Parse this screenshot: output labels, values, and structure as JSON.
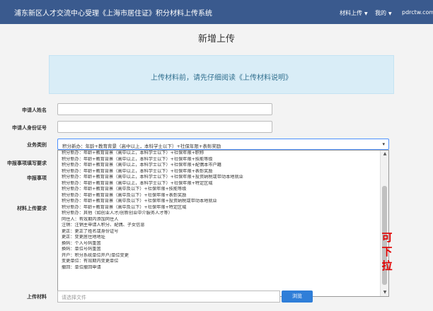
{
  "navbar": {
    "title": "浦东新区人才交流中心受理《上海市居住证》积分材料上传系统",
    "menu_material": "材料上传",
    "menu_mine": "我的",
    "site": "pdrctw.com"
  },
  "page_title": "新增上传",
  "notice": "上传材料前，请先仔细阅读《上传材料说明》",
  "form": {
    "labels": {
      "name": "申请人姓名",
      "id_number": "申请人身份证号",
      "business_type": "业务类别",
      "fill_requirements": "申报事项填写要求",
      "apply_items": "申报事项",
      "material_requirements": "材料上传要求",
      "upload_material": "上传材料"
    },
    "business_type_selected": "积分新办：年龄+教育背景（高中以上，本科学士以下）+社保年限+表彰奖励",
    "file_placeholder": "请选择文件",
    "browse_label": "浏览"
  },
  "dropdown_options": [
    "积分新办：年龄+教育背景（高中以上，本科学士以下）+社保年限+职称",
    "积分新办：年龄+教育背景（高中以上，本科学士以下）+社保年限+技能等级",
    "积分新办：年龄+教育背景（高中以上，本科学士以下）+社保年限+配偶本市户籍",
    "积分新办：年龄+教育背景（高中以上，本科学士以下）+社保年限+表彰奖励",
    "积分新办：年龄+教育背景（高中以上，本科学士以下）+社保年限+投资纳税或带动本地就业",
    "积分新办：年龄+教育背景（高中以上，本科学士以下）+社保年限+特定区域",
    "积分新办：年龄+教育背景（高中及以下）+社保年限+技能等级",
    "积分新办：年龄+教育背景（高中及以下）+社保年限+表彰奖励",
    "积分新办：年龄+教育背景（高中及以下）+社保年限+投资纳税或带动本地就业",
    "积分新办：年龄+教育背景（高中及以下）+社保年限+特定区域",
    "积分新办：其他（如创业人才/创新创业中介服务人才等）",
    "同住人：有效期内添加同住人",
    "注销：注销主申请人积分、配偶、子女信息",
    "更正：更正了姓名或身份证号",
    "更正：变更居住地地址",
    "换码：个人号码重置",
    "换码：单位号码重置",
    "开户：积分系统单位开户/单位变更",
    "变更单位：有效期内变更单位",
    "撤回：单位撤回申请"
  ],
  "annotation": [
    "可",
    "下",
    "拉"
  ]
}
